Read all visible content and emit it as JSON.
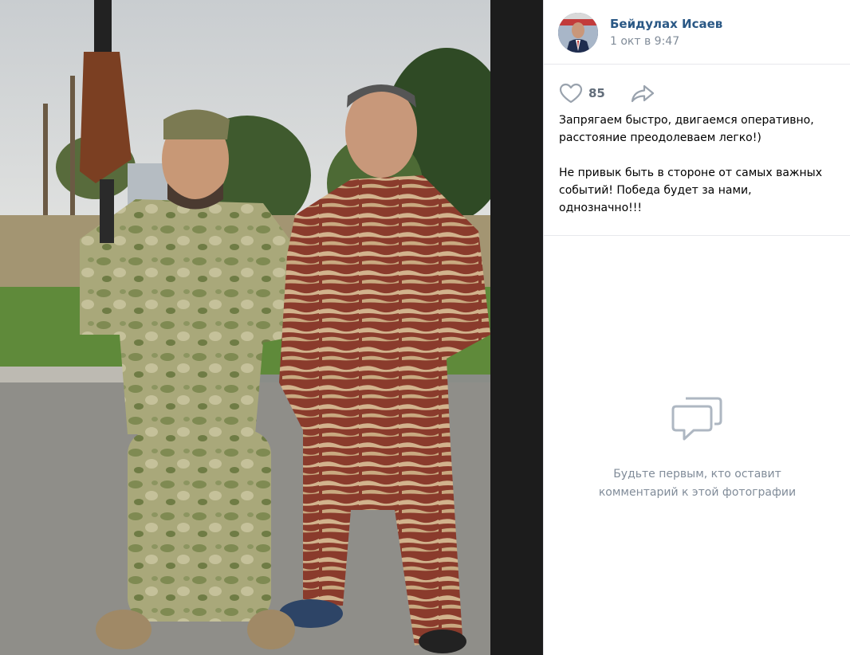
{
  "post": {
    "author": "Бейдулах Исаев",
    "date": "1 окт в 9:47",
    "likes": "85",
    "caption_line1": "Запрягаем быстро, двигаемся оперативно,",
    "caption_line2": "расстояние преодолеваем легко!)",
    "caption_line3": "Не привык быть в стороне от самых важных",
    "caption_line4": "событий! Победа будет за нами,",
    "caption_line5": "однозначно!!!"
  },
  "comments": {
    "empty_line1": "Будьте первым, кто оставит",
    "empty_line2": "комментарий к этой фотографии"
  },
  "icons": {
    "like": "heart-icon",
    "share": "share-arrow-icon",
    "comments_empty": "speech-bubbles-icon"
  },
  "colors": {
    "author_link": "#2a5885",
    "muted_text": "#818c99",
    "like_count": "#626d7a",
    "icon_gray": "#99a2ad",
    "viewer_background": "#1c1c1c"
  }
}
